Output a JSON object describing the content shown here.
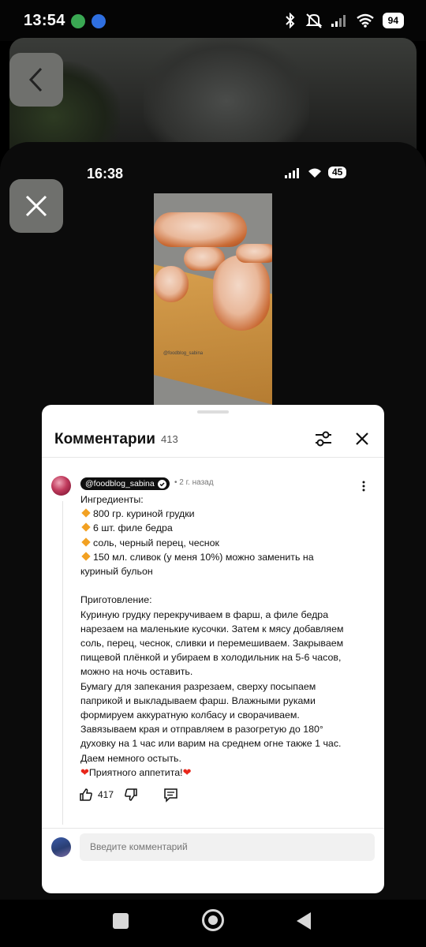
{
  "status_bar": {
    "time": "13:54",
    "battery": "94"
  },
  "inner_status_bar": {
    "time": "16:38",
    "battery": "45"
  },
  "video": {
    "watermark": "@foodblog_sabina"
  },
  "comments_panel": {
    "title": "Комментарии",
    "count": "413"
  },
  "comment": {
    "author": "@foodblog_sabina",
    "date": "• 2 г. назад",
    "lines": [
      "Ингредиенты:",
      "800 гр. куриной грудки",
      "6 шт. филе бедра",
      "соль, черный перец, чеснок",
      "150 мл. сливок (у меня 10%) можно заменить на",
      "куриный бульон",
      "",
      "Приготовление:",
      "Куриную грудку перекручиваем в фарш, а филе бедра",
      "нарезаем на маленькие кусочки. Затем к мясу добавляем",
      "соль, перец, чеснок, сливки и перемешиваем. Закрываем",
      "пищевой плёнкой и убираем в холодильник на 5-6 часов,",
      "можно на ночь оставить.",
      "Бумагу для запекания разрезаем, сверху посыпаем",
      "паприкой и выкладываем фарш. Влажными руками",
      "формируем аккуратную колбасу и сворачиваем.",
      "Завязываем края и отправляем в разогретую до 180°",
      "духовку на 1 час или варим на среднем огне также 1 час.",
      "Даем немного остыть.",
      "Приятного аппетита!"
    ],
    "likes": "417"
  },
  "reply_input": {
    "placeholder": "Введите комментарий"
  },
  "colors": {
    "accent_diamond": "#f2a122",
    "heart": "#e8261a"
  }
}
